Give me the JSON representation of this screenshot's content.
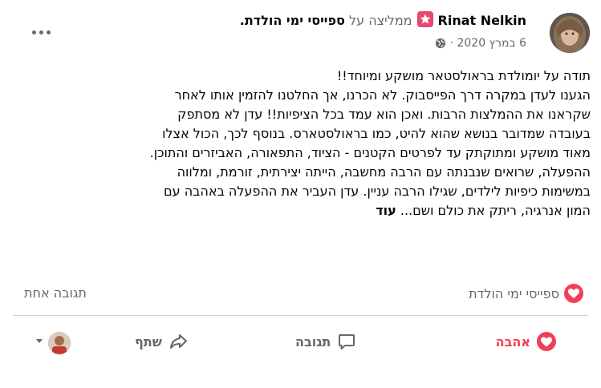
{
  "post": {
    "author_name": "Rinat Nelkin",
    "recommends_verb": "ממליצה על",
    "page_name": "ספייסי ימי הולדת",
    "page_name_suffix": ".",
    "date": "6 במרץ 2020",
    "separator": "·",
    "text_lines": [
      "תודה על יומולדת בראולסטאר מושקע ומיוחד!!",
      "הגענו לעדן במקרה דרך הפייסבוק. לא הכרנו, אך החלטנו להזמין אותו לאחר",
      "שקראנו את ההמלצות הרבות. ואכן הוא עמד בכל הציפיות!! עדן לא מסתפק",
      "בעובדה שמדובר בנושא שהוא להיט, כמו בראולסטארס. בנוסף לכך, הכול אצלו",
      "מאוד מושקע ומתוקתק עד לפרטים הקטנים - הציוד, התפאורה, האביזרים והתוכן.",
      "ההפעלה, שרואים שנבנתה עם הרבה מחשבה, הייתה יצירתית, זורמת, ומלווה",
      "במשימות כיפיות לילדים, שגילו הרבה עניין. עדן העביר את ההפעלה באהבה עם"
    ],
    "last_line_text": "המון אנרגיה, ריתק את כולם ושם...",
    "more_label": "עוד"
  },
  "stats": {
    "reaction_by": "ספייסי ימי הולדת",
    "comments_count": "תגובה אחת"
  },
  "actions": {
    "love_label": "אהבה",
    "comment_label": "תגובה",
    "share_label": "שתף"
  },
  "colors": {
    "love": "#f33e58",
    "recommend_badge": "#e84770",
    "secondary_text": "#65676b"
  },
  "icons": {
    "more": "more-horizontal-icon",
    "privacy": "globe-icon",
    "recommend": "star-badge-icon",
    "reaction": "heart-icon",
    "comment": "speech-bubble-icon",
    "share": "share-arrow-icon",
    "audience_caret": "caret-down-icon"
  }
}
